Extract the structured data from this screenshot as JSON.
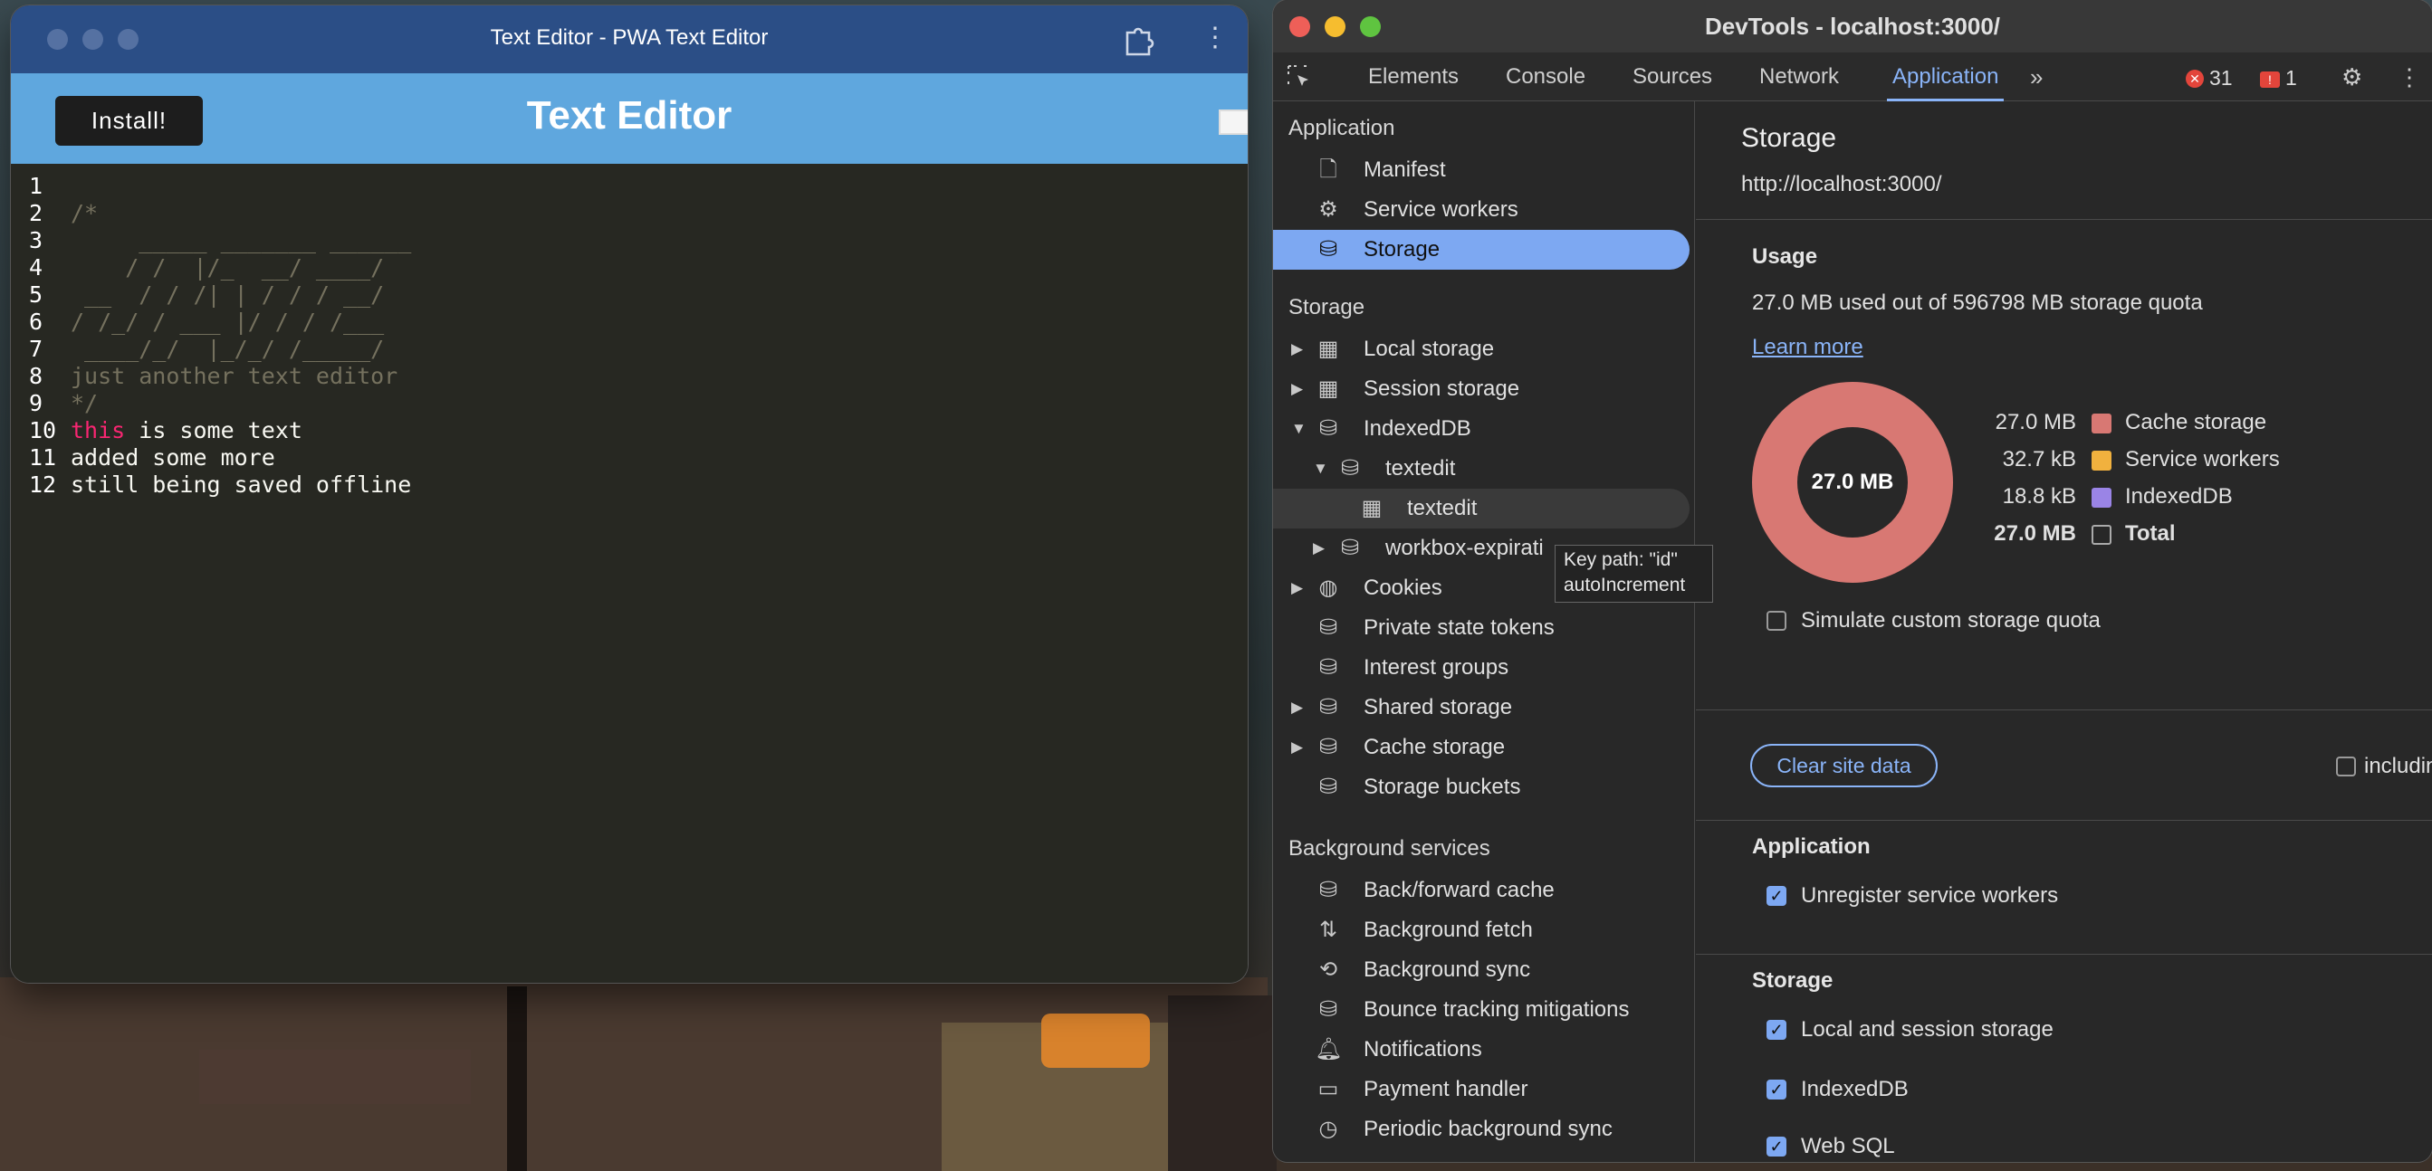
{
  "app": {
    "window_title": "Text Editor - PWA Text Editor",
    "install_label": "Install!",
    "header_title": "Text Editor",
    "lines": [
      {
        "n": "1",
        "parts": []
      },
      {
        "n": "2",
        "parts": [
          {
            "c": "cm",
            "t": "/*"
          }
        ]
      },
      {
        "n": "3",
        "parts": [
          {
            "c": "cm",
            "t": "     _____ _______ ______"
          }
        ]
      },
      {
        "n": "4",
        "parts": [
          {
            "c": "cm",
            "t": "    / /  |/_  __/ ____/"
          }
        ]
      },
      {
        "n": "5",
        "parts": [
          {
            "c": "cm",
            "t": " __  / / /| | / / / __/"
          }
        ]
      },
      {
        "n": "6",
        "parts": [
          {
            "c": "cm",
            "t": "/ /_/ / ___ |/ / / /___"
          }
        ]
      },
      {
        "n": "7",
        "parts": [
          {
            "c": "cm",
            "t": " ____/_/  |_/_/ /_____/"
          }
        ]
      },
      {
        "n": "8",
        "parts": [
          {
            "c": "cm",
            "t": "just another text editor"
          }
        ]
      },
      {
        "n": "9",
        "parts": [
          {
            "c": "cm",
            "t": "*/"
          }
        ]
      },
      {
        "n": "10",
        "parts": [
          {
            "c": "kw",
            "t": "this"
          },
          {
            "c": "tx",
            "t": " is some text"
          }
        ]
      },
      {
        "n": "11",
        "parts": [
          {
            "c": "tx",
            "t": "added some more"
          }
        ]
      },
      {
        "n": "12",
        "parts": [
          {
            "c": "tx",
            "t": "still being saved offline"
          }
        ]
      }
    ]
  },
  "devtools": {
    "window_title": "DevTools - localhost:3000/",
    "tabs": [
      "Elements",
      "Console",
      "Sources",
      "Network",
      "Application"
    ],
    "active_tab": "Application",
    "error_count": "31",
    "warning_count": "1",
    "sidebar": {
      "application_heading": "Application",
      "application_items": [
        "Manifest",
        "Service workers",
        "Storage"
      ],
      "storage_heading": "Storage",
      "storage_items": [
        "Local storage",
        "Session storage",
        "IndexedDB",
        "textedit",
        "textedit",
        "workbox-expirati",
        "Cookies",
        "Private state tokens",
        "Interest groups",
        "Shared storage",
        "Cache storage",
        "Storage buckets"
      ],
      "background_heading": "Background services",
      "background_items": [
        "Back/forward cache",
        "Background fetch",
        "Background sync",
        "Bounce tracking mitigations",
        "Notifications",
        "Payment handler",
        "Periodic background sync"
      ]
    },
    "tooltip": {
      "line1": "Key path: \"id\"",
      "line2": "autoIncrement"
    },
    "main": {
      "title": "Storage",
      "origin": "http://localhost:3000/",
      "usage_heading": "Usage",
      "usage_text": "27.0 MB used out of 596798 MB storage quota",
      "learn_more": "Learn more",
      "donut_label": "27.0 MB",
      "legend": [
        {
          "value": "27.0 MB",
          "name": "Cache storage",
          "color": "#d87873"
        },
        {
          "value": "32.7 kB",
          "name": "Service workers",
          "color": "#f1b13e"
        },
        {
          "value": "18.8 kB",
          "name": "IndexedDB",
          "color": "#9a84e6"
        },
        {
          "value": "27.0 MB",
          "name": "Total",
          "color": ""
        }
      ],
      "simulate_quota": "Simulate custom storage quota",
      "clear_button": "Clear site data",
      "third_party": "including third-party cookies",
      "app_heading": "Application",
      "unregister": "Unregister service workers",
      "storage_heading": "Storage",
      "local_session": "Local and session storage",
      "indexeddb": "IndexedDB",
      "websql": "Web SQL"
    }
  }
}
